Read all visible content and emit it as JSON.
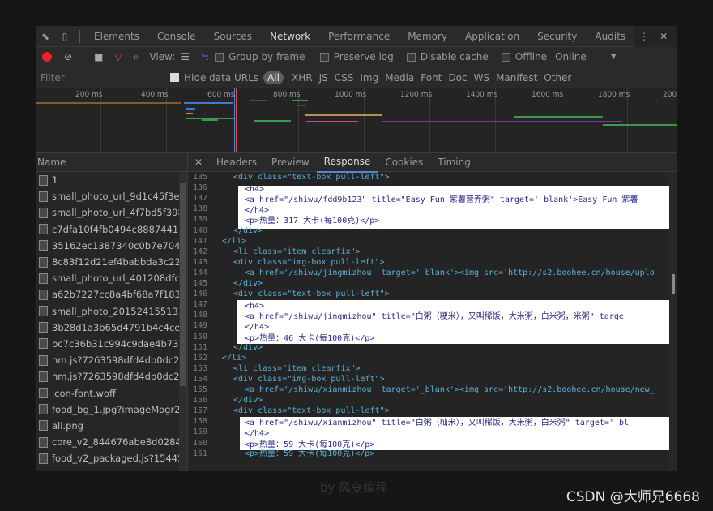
{
  "devtools": {
    "tabs": [
      "Elements",
      "Console",
      "Sources",
      "Network",
      "Performance",
      "Memory",
      "Application",
      "Security",
      "Audits"
    ],
    "active_tab": "Network",
    "toolbar": {
      "view_label": "View:",
      "group_by_frame": "Group by frame",
      "preserve_log": "Preserve log",
      "disable_cache": "Disable cache",
      "offline": "Offline",
      "throttle": "Online"
    },
    "filter": {
      "placeholder": "Filter",
      "hide_data_urls": "Hide data URLs",
      "types": [
        "All",
        "XHR",
        "JS",
        "CSS",
        "Img",
        "Media",
        "Font",
        "Doc",
        "WS",
        "Manifest",
        "Other"
      ]
    },
    "overview_ticks": [
      "200 ms",
      "400 ms",
      "600 ms",
      "800 ms",
      "1000 ms",
      "1200 ms",
      "1400 ms",
      "1600 ms",
      "1800 ms",
      "200"
    ],
    "request_list": {
      "header": "Name",
      "files": [
        "1",
        "small_photo_url_9d1c45f3e8d",
        "small_photo_url_4f7bd5f3985.",
        "c7dfa10f4fb0494c8887441e42",
        "35162ec1387340c0b7e704c69",
        "8c83f12d21ef4babbda3c22fec",
        "small_photo_url_401208dfc32",
        "a62b7227cc8a4bf68a7f183a4c",
        "small_photo_2015241551331€",
        "3b28d1a3b65d4791b4c4ce25.",
        "bc7c36b31c994c9dae4b73000",
        "hm.js?7263598dfd4db0dc295.",
        "hm.js?7263598dfd4db0dc295.",
        "icon-font.woff",
        "food_bg_1.jpg?imageMogr2/c",
        "all.png",
        "core_v2_844676abe8d02848b",
        "food_v2_packaged.js?1544507"
      ]
    },
    "detail_tabs": [
      "Headers",
      "Preview",
      "Response",
      "Cookies",
      "Timing"
    ],
    "active_detail_tab": "Response",
    "line_numbers": [
      "135",
      "136",
      "137",
      "138",
      "139",
      "140",
      "141",
      "142",
      "143",
      "144",
      "145",
      "146",
      "147",
      "148",
      "149",
      "150",
      "151",
      "152",
      "153",
      "154",
      "155",
      "156",
      "157",
      "158",
      "159",
      "160",
      "161"
    ],
    "source_lines": [
      "<div class=\"text-box pull-left\">",
      "<h4>",
      "<a href=\"/shiwu/fdd9b123\" title=\"Easy Fun 紫薯营养粥\" target='_blank'>Easy Fun 紫薯",
      "</h4>",
      "<p>热量：317 大卡(每100克)</p>",
      "</div>",
      "</li>",
      "<li class=\"item clearfix\">",
      "<div class=\"img-box pull-left\">",
      "<a href='/shiwu/jingmizhou' target='_blank'><img src='http://s2.boohee.cn/house/uplo",
      "</div>",
      "<div class=\"text-box pull-left\">",
      "<h4>",
      "<a href=\"/shiwu/jingmizhou\" title=\"白粥（粳米），又叫稀饭，大米粥，白米粥，米粥\" targe",
      "</h4>",
      "<p>热量：46 大卡(每100克)</p>",
      "</div>",
      "</li>",
      "<li class=\"item clearfix\">",
      "<div class=\"img-box pull-left\">",
      "<a href='/shiwu/xianmizhou' target='_blank'><img src='http://s2.boohee.cn/house/new_",
      "</div>",
      "<div class=\"text-box pull-left\">",
      "<a href=\"/shiwu/xianmizhou\" title=\"白粥（籼米），又叫稀饭，大米粥，白米粥\" target='_bl",
      "</h4>",
      "<p>热量：59 大卡(每100克)</p>",
      "<p>热量：59 大卡(每100克)</p>"
    ]
  },
  "footer": {
    "byline": "by 风变编程",
    "watermark": "CSDN @大师兄6668"
  },
  "colors": {
    "accent": "#4b89dc",
    "record": "#e22222"
  }
}
